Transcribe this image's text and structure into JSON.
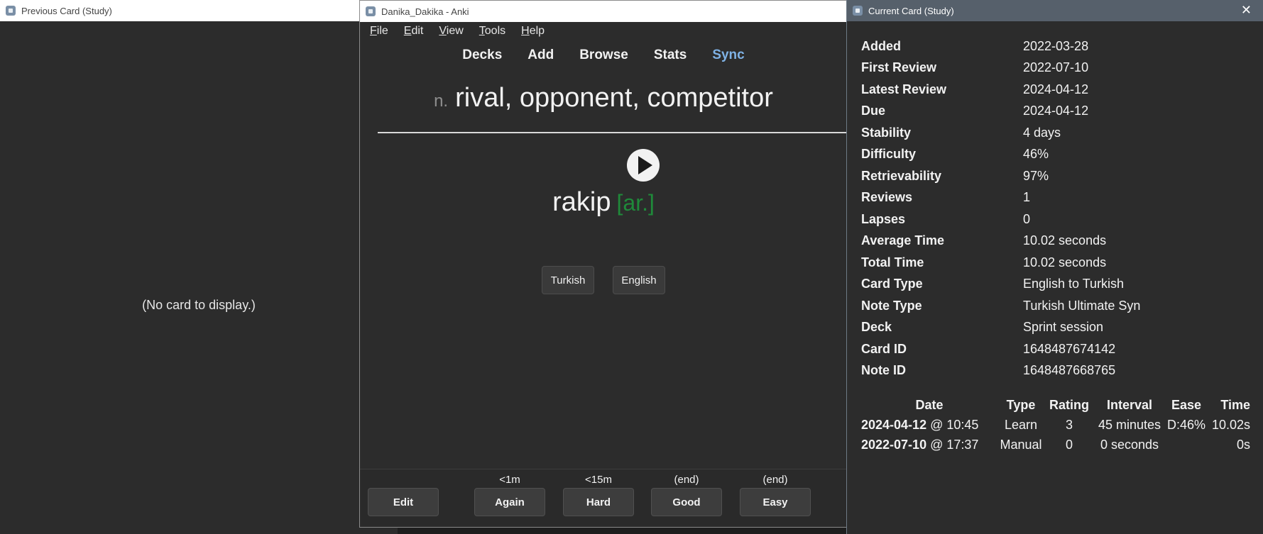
{
  "prev_window": {
    "title": "Previous Card (Study)",
    "empty_text": "(No card to display.)"
  },
  "main_window": {
    "title": "Danika_Dakika - Anki",
    "menu": [
      {
        "under": "F",
        "rest": "ile"
      },
      {
        "under": "E",
        "rest": "dit"
      },
      {
        "under": "V",
        "rest": "iew"
      },
      {
        "under": "T",
        "rest": "ools"
      },
      {
        "under": "H",
        "rest": "elp"
      }
    ],
    "toolbar": {
      "decks": "Decks",
      "add": "Add",
      "browse": "Browse",
      "stats": "Stats",
      "sync": "Sync"
    },
    "card": {
      "pos": "n.",
      "meaning": "rival, opponent, competitor",
      "word": "rakip",
      "tag": "[ar.]",
      "lang1": "Turkish",
      "lang2": "English"
    },
    "answer_bar": {
      "edit": "Edit",
      "again": {
        "label": "Again",
        "time": "<1m"
      },
      "hard": {
        "label": "Hard",
        "time": "<15m"
      },
      "good": {
        "label": "Good",
        "time": "(end)"
      },
      "easy": {
        "label": "Easy",
        "time": "(end)"
      }
    }
  },
  "info_window": {
    "title": "Current Card (Study)",
    "close": "✕",
    "stats": [
      {
        "label": "Added",
        "value": "2022-03-28"
      },
      {
        "label": "First Review",
        "value": "2022-07-10"
      },
      {
        "label": "Latest Review",
        "value": "2024-04-12"
      },
      {
        "label": "Due",
        "value": "2024-04-12"
      },
      {
        "label": "Stability",
        "value": "4 days"
      },
      {
        "label": "Difficulty",
        "value": "46%"
      },
      {
        "label": "Retrievability",
        "value": "97%"
      },
      {
        "label": "Reviews",
        "value": "1"
      },
      {
        "label": "Lapses",
        "value": "0"
      },
      {
        "label": "Average Time",
        "value": "10.02 seconds"
      },
      {
        "label": "Total Time",
        "value": "10.02 seconds"
      },
      {
        "label": "Card Type",
        "value": "English to Turkish"
      },
      {
        "label": "Note Type",
        "value": "Turkish Ultimate Syn"
      },
      {
        "label": "Deck",
        "value": "Sprint session"
      },
      {
        "label": "Card ID",
        "value": "1648487674142"
      },
      {
        "label": "Note ID",
        "value": "1648487668765"
      }
    ],
    "review_headers": {
      "date": "Date",
      "type": "Type",
      "rating": "Rating",
      "interval": "Interval",
      "ease": "Ease",
      "time": "Time"
    },
    "reviews": [
      {
        "date": "2024-04-12",
        "clock": "@ 10:45",
        "type": "Learn",
        "rating": "3",
        "interval": "45 minutes",
        "ease": "D:46%",
        "time": "10.02s"
      },
      {
        "date": "2022-07-10",
        "clock": "@ 17:37",
        "type": "Manual",
        "rating": "0",
        "interval": "0 seconds",
        "ease": "",
        "time": "0s"
      }
    ]
  }
}
